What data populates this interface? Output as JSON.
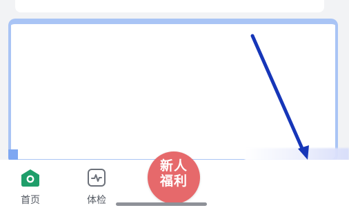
{
  "tab_bar": {
    "items": [
      {
        "label": "首页",
        "icon": "home-icon",
        "active": true
      },
      {
        "label": "体检",
        "icon": "checkup-icon",
        "active": false
      }
    ],
    "promo": {
      "line1": "新人",
      "line2": "福利",
      "color": "#e6696b"
    }
  },
  "colors": {
    "accent": "#1f9e6a",
    "card_border": "#a9c4f5",
    "annotation_arrow": "#1636b8"
  }
}
